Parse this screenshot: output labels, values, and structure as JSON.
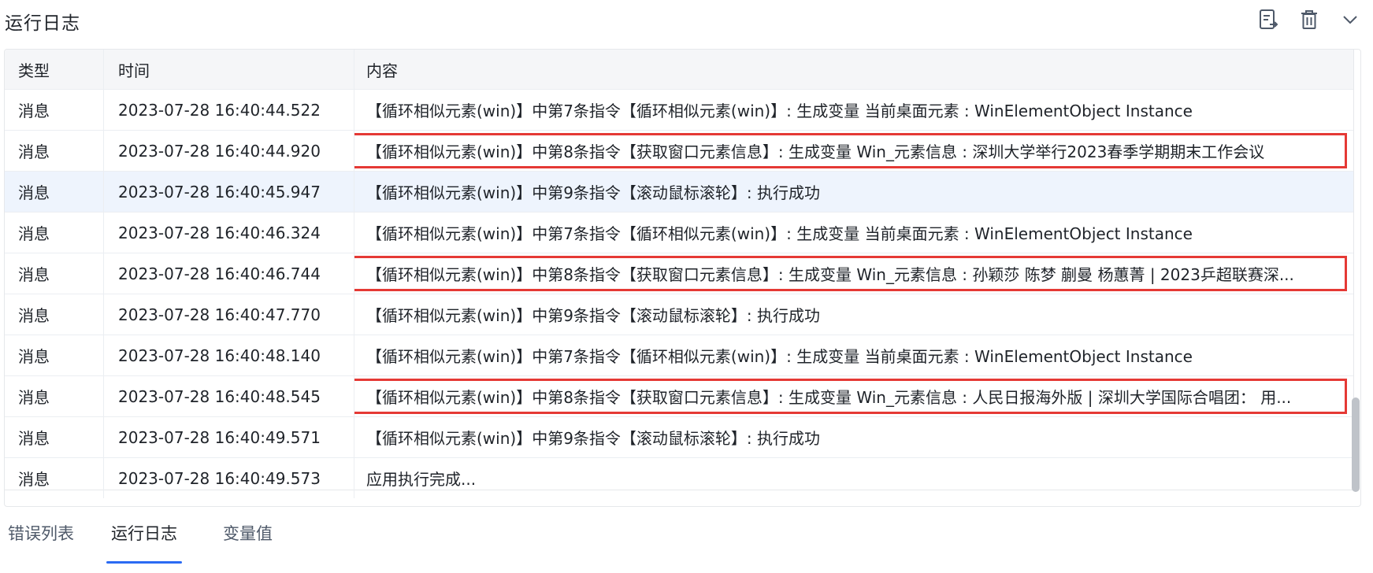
{
  "panel": {
    "title": "运行日志",
    "icons": [
      "export-log-icon",
      "trash-icon",
      "chevron-down-icon"
    ]
  },
  "table": {
    "headers": {
      "type": "类型",
      "time": "时间",
      "content": "内容"
    },
    "rows": [
      {
        "type": "消息",
        "time": "2023-07-28 16:40:44.522",
        "content": "【循环相似元素(win)】中第7条指令【循环相似元素(win)】: 生成变量 当前桌面元素 : WinElementObject Instance"
      },
      {
        "type": "消息",
        "time": "2023-07-28 16:40:44.920",
        "content": "【循环相似元素(win)】中第8条指令【获取窗口元素信息】: 生成变量 Win_元素信息 : 深圳大学举行2023春季学期期末工作会议"
      },
      {
        "type": "消息",
        "time": "2023-07-28 16:40:45.947",
        "content": "【循环相似元素(win)】中第9条指令【滚动鼠标滚轮】: 执行成功"
      },
      {
        "type": "消息",
        "time": "2023-07-28 16:40:46.324",
        "content": "【循环相似元素(win)】中第7条指令【循环相似元素(win)】: 生成变量 当前桌面元素 : WinElementObject Instance"
      },
      {
        "type": "消息",
        "time": "2023-07-28 16:40:46.744",
        "content": "【循环相似元素(win)】中第8条指令【获取窗口元素信息】: 生成变量 Win_元素信息 : 孙颖莎 陈梦 蒯曼 杨蕙菁 | 2023乒超联赛深..."
      },
      {
        "type": "消息",
        "time": "2023-07-28 16:40:47.770",
        "content": "【循环相似元素(win)】中第9条指令【滚动鼠标滚轮】: 执行成功"
      },
      {
        "type": "消息",
        "time": "2023-07-28 16:40:48.140",
        "content": "【循环相似元素(win)】中第7条指令【循环相似元素(win)】: 生成变量 当前桌面元素 : WinElementObject Instance"
      },
      {
        "type": "消息",
        "time": "2023-07-28 16:40:48.545",
        "content": "【循环相似元素(win)】中第8条指令【获取窗口元素信息】: 生成变量 Win_元素信息 : 人民日报海外版 | 深圳大学国际合唱团：  用..."
      },
      {
        "type": "消息",
        "time": "2023-07-28 16:40:49.571",
        "content": "【循环相似元素(win)】中第9条指令【滚动鼠标滚轮】: 执行成功"
      },
      {
        "type": "消息",
        "time": "2023-07-28 16:40:49.573",
        "content": "应用执行完成..."
      }
    ],
    "selected_row": 2,
    "highlighted_rows": [
      1,
      4,
      7
    ]
  },
  "tabs": [
    {
      "label": "错误列表",
      "active": false
    },
    {
      "label": "运行日志",
      "active": true
    },
    {
      "label": "变量值",
      "active": false
    }
  ],
  "colors": {
    "accent": "#2b6bf3",
    "highlight_box": "#e53935",
    "selected_row": "#eef4fd"
  }
}
